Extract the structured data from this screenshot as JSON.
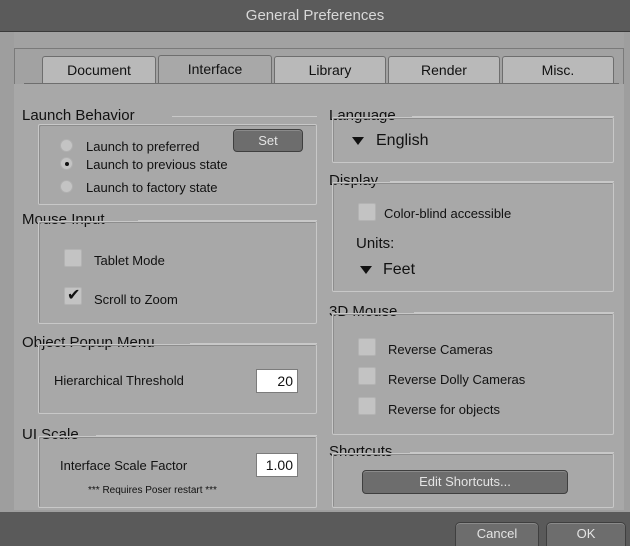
{
  "window": {
    "title": "General Preferences"
  },
  "tabs": [
    {
      "label": "Document",
      "active": false
    },
    {
      "label": "Interface",
      "active": true
    },
    {
      "label": "Library",
      "active": false
    },
    {
      "label": "Render",
      "active": false
    },
    {
      "label": "Misc.",
      "active": false
    }
  ],
  "launch_behavior": {
    "title": "Launch Behavior",
    "options": [
      {
        "label": "Launch to preferred",
        "selected": false
      },
      {
        "label": "Launch to previous state",
        "selected": true
      },
      {
        "label": "Launch to factory state",
        "selected": false
      }
    ],
    "set_label": "Set"
  },
  "mouse_input": {
    "title": "Mouse Input",
    "tablet_mode": {
      "label": "Tablet Mode",
      "checked": false
    },
    "scroll_to_zoom": {
      "label": "Scroll to Zoom",
      "checked": true
    }
  },
  "object_popup": {
    "title": "Object Popup Menu",
    "threshold_label": "Hierarchical Threshold",
    "threshold_value": "20"
  },
  "ui_scale": {
    "title": "UI Scale",
    "factor_label": "Interface Scale Factor",
    "factor_value": "1.00",
    "note": "*** Requires Poser restart ***"
  },
  "language": {
    "title": "Language",
    "selected": "English"
  },
  "display": {
    "title": "Display",
    "color_blind": {
      "label": "Color-blind accessible",
      "checked": false
    },
    "units_label": "Units:",
    "units_value": "Feet"
  },
  "mouse_3d": {
    "title": "3D Mouse",
    "options": [
      {
        "label": "Reverse Cameras",
        "checked": false
      },
      {
        "label": "Reverse Dolly Cameras",
        "checked": false
      },
      {
        "label": "Reverse for objects",
        "checked": false
      }
    ]
  },
  "shortcuts": {
    "title": "Shortcuts",
    "edit_label": "Edit Shortcuts..."
  },
  "footer": {
    "cancel_label": "Cancel",
    "ok_label": "OK"
  },
  "colors": {
    "titlebar": "#5b5b5b",
    "panel": "#a8a8a8",
    "button": "#6d6d6d"
  }
}
